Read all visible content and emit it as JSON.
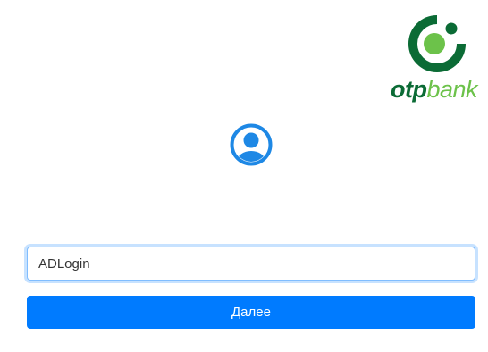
{
  "logo": {
    "text_primary": "otp",
    "text_secondary": "bank",
    "dark_green": "#0b6b35",
    "light_green": "#6cc24a",
    "mark_icon": "otp-ring-icon"
  },
  "avatar": {
    "icon": "user-circle-icon",
    "color": "#1e88e5"
  },
  "login": {
    "value": "ADLogin",
    "placeholder": ""
  },
  "next_button": {
    "label": "Далее",
    "color": "#007bff"
  }
}
